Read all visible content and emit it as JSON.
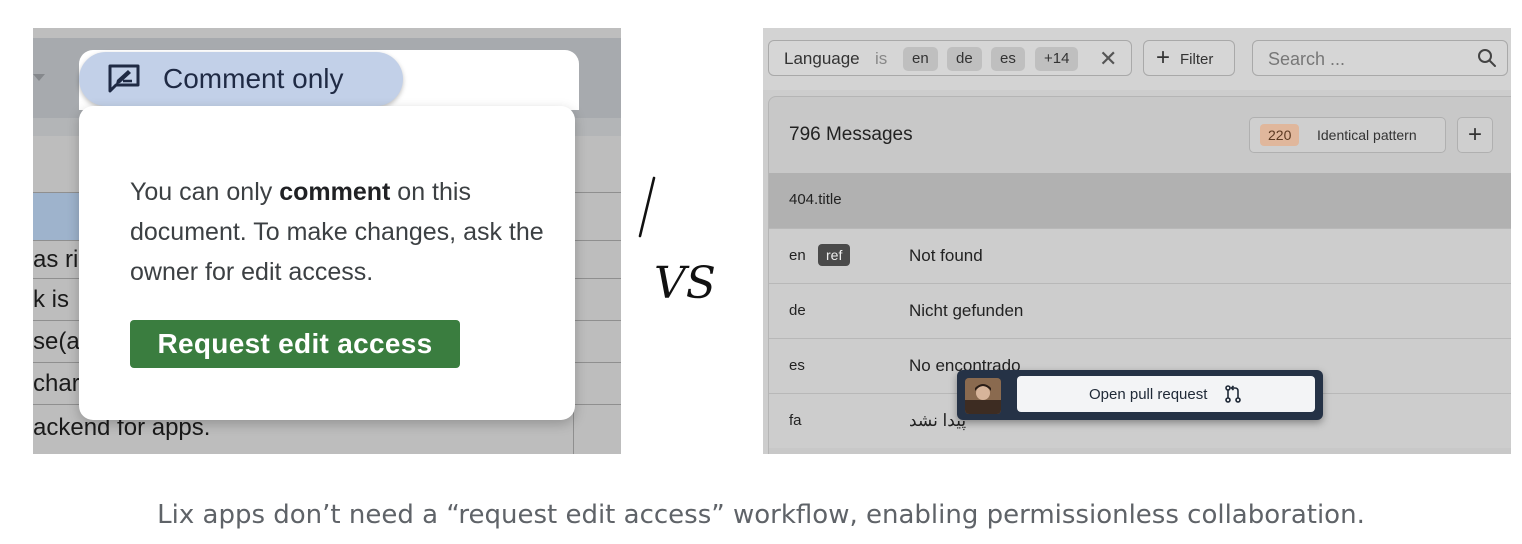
{
  "left_panel": {
    "chip_label": "Comment only",
    "chip_icon": "comment-edit-icon",
    "message": {
      "prefix": "You can only ",
      "bold": "comment",
      "suffix": " on this document. To make changes, ask the owner for edit access."
    },
    "request_button": "Request edit access",
    "background_rows": [
      "as ri",
      "k is",
      "se(al",
      "char",
      "ackend for apps."
    ]
  },
  "divider": {
    "slash": "/",
    "vs": "VS"
  },
  "right_panel": {
    "filter": {
      "label": "Language",
      "operator": "is",
      "chips": [
        "en",
        "de",
        "es",
        "+14"
      ]
    },
    "filter_button": "Filter",
    "search_placeholder": "Search ...",
    "messages_title": "796 Messages",
    "identical": {
      "count": "220",
      "label": "Identical pattern"
    },
    "key": "404.title",
    "rows": [
      {
        "lang": "en",
        "badge": "ref",
        "value": "Not found"
      },
      {
        "lang": "de",
        "badge": "",
        "value": "Nicht gefunden"
      },
      {
        "lang": "es",
        "badge": "",
        "value": "No encontrado"
      },
      {
        "lang": "fa",
        "badge": "",
        "value": "پیدا نشد"
      }
    ],
    "pr_button": "Open pull request"
  },
  "caption": "Lix apps don’t need a “request edit access” workflow, enabling permissionless collaboration.",
  "colors": {
    "request_button": "#3a7d3f",
    "chip_background": "#c2d0e8",
    "identical_badge": "#e0b79c",
    "pr_popup": "#253246"
  }
}
